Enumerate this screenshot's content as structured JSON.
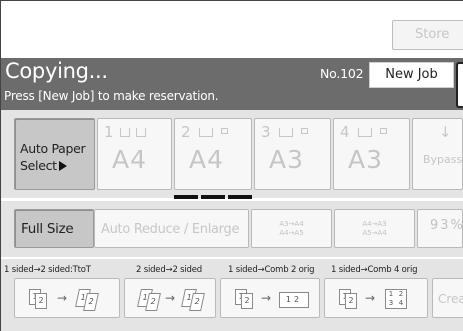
{
  "top": {
    "store_label": "Store"
  },
  "header": {
    "title": "Copying...",
    "subtitle": "Press [New Job] to make reservation.",
    "job_number": "No.102",
    "new_job_label": "New Job"
  },
  "paper": {
    "auto_paper_line1": "Auto Paper",
    "auto_paper_line2": "Select",
    "trays": [
      {
        "number": "1",
        "size": "A4"
      },
      {
        "number": "2",
        "size": "A4"
      },
      {
        "number": "3",
        "size": "A3"
      },
      {
        "number": "4",
        "size": "A3"
      }
    ],
    "bypass_label": "Bypass"
  },
  "reduce": {
    "full_size_label": "Full Size",
    "auto_reduce_label": "Auto Reduce / Enlarge",
    "ratio1_line1": "A3→A4",
    "ratio1_line2": "A4→A5",
    "ratio2_line1": "A4→A3",
    "ratio2_line2": "A5→A4",
    "ratio3": "93%"
  },
  "duplex": {
    "labels": [
      "1 sided→2 sided:TtoT",
      "2 sided→2 sided",
      "1 sided→Comb 2 orig",
      "1 sided→Comb 4 orig"
    ],
    "create_label": "Crea"
  }
}
